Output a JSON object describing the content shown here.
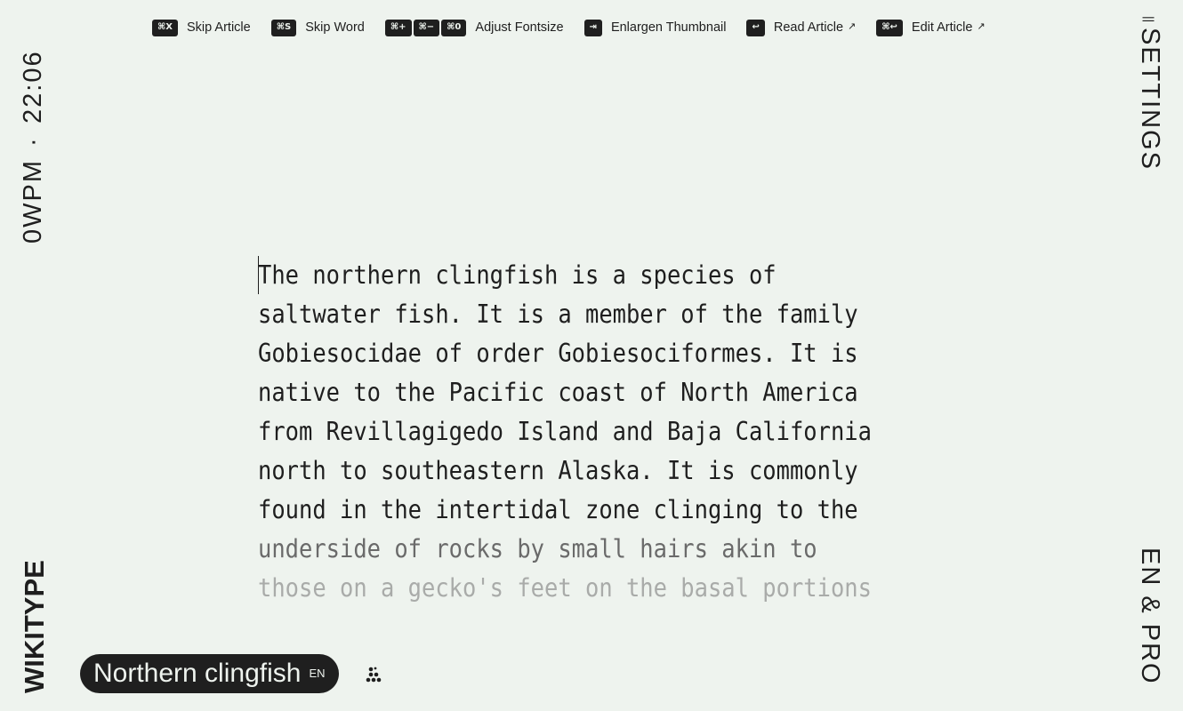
{
  "shortcuts": [
    {
      "keys": [
        "⌘X"
      ],
      "label": "Skip Article",
      "external": false
    },
    {
      "keys": [
        "⌘S"
      ],
      "label": "Skip Word",
      "external": false
    },
    {
      "keys": [
        "⌘+",
        "⌘−",
        "⌘0"
      ],
      "label": "Adjust Fontsize",
      "external": false
    },
    {
      "keys": [
        "⇥"
      ],
      "label": "Enlargen Thumbnail",
      "external": false
    },
    {
      "keys": [
        "↩"
      ],
      "label": "Read Article",
      "external": true
    },
    {
      "keys": [
        "⌘↩"
      ],
      "label": "Edit Article",
      "external": true
    }
  ],
  "external_arrow": "↗",
  "stats": {
    "wpm": "0WPM",
    "separator": "·",
    "clock": "22:06"
  },
  "brand": "WIKITYPE",
  "settings": {
    "grip": "||",
    "label": "SETTINGS"
  },
  "mode": "EN & PRO",
  "article": {
    "lines": [
      "The northern clingfish is a species of",
      "saltwater fish. It is a member of the family",
      "Gobiesocidae of order Gobiesociformes. It is",
      "native to the Pacific coast of North America",
      "from Revillagigedo Island and Baja California",
      "north to southeastern Alaska. It is commonly",
      "found in the intertidal zone clinging to the",
      "underside of rocks by small hairs akin to",
      "those on a gecko's feet on the basal portions"
    ]
  },
  "title": {
    "text": "Northern clingfish",
    "lang": "EN"
  },
  "icons": {
    "shuffle": "shuffle-icon",
    "external": "external-link-icon",
    "caret": "text-caret"
  },
  "colors": {
    "background": "#eef3ee",
    "text": "#1e1e1e",
    "pill": "#1f1f1f",
    "fade_mid": "#6a6a6a",
    "fade_light": "#a9aba9"
  }
}
